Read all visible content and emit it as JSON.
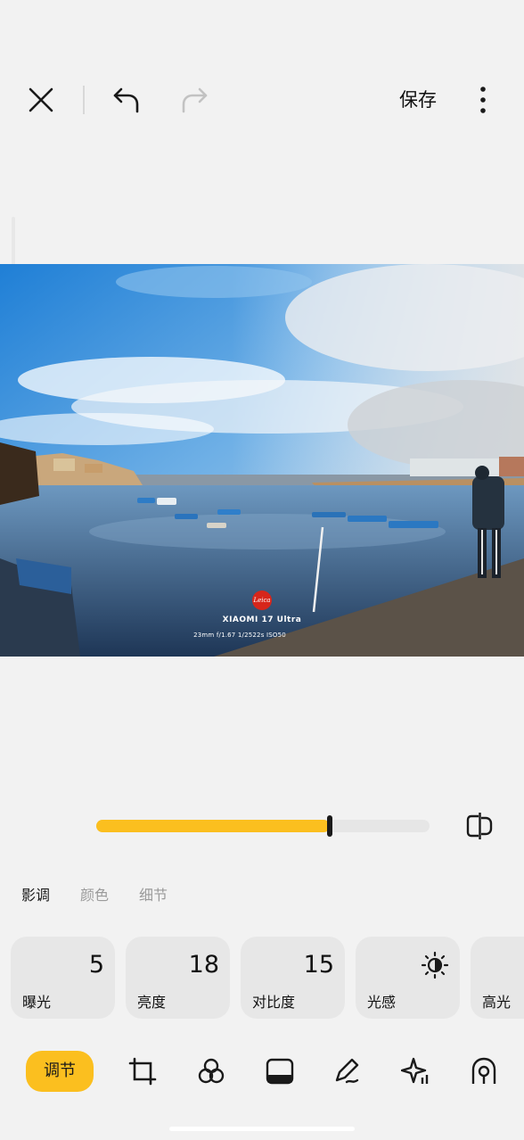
{
  "toolbar_top": {
    "close_icon": "close-icon",
    "undo_icon": "undo-icon",
    "redo_icon": "redo-icon",
    "save_label": "保存",
    "more_icon": "more-vertical-icon"
  },
  "photo": {
    "watermark_logo": "Leica",
    "watermark_brand": "XIAOMI 17 Ultra",
    "watermark_specs": "23mm  f/1.67  1/2522s  ISO50"
  },
  "slider": {
    "value_fraction": 0.7,
    "compare_icon": "compare-icon"
  },
  "tabs": [
    {
      "label": "影调",
      "active": true
    },
    {
      "label": "颜色",
      "active": false
    },
    {
      "label": "细节",
      "active": false
    }
  ],
  "cards": [
    {
      "label": "曝光",
      "value": "5"
    },
    {
      "label": "亮度",
      "value": "18"
    },
    {
      "label": "对比度",
      "value": "15"
    },
    {
      "label": "光感",
      "icon": "brightness-sun-icon"
    },
    {
      "label": "高光",
      "value": ""
    }
  ],
  "bottom_tools": {
    "active_label": "调节",
    "tools": [
      "crop-icon",
      "filter-icon",
      "frame-icon",
      "draw-icon",
      "ai-sparkle-icon",
      "portrait-icon"
    ]
  },
  "colors": {
    "accent": "#fbbf1f",
    "background": "#f2f2f2",
    "card": "#e7e7e7"
  }
}
